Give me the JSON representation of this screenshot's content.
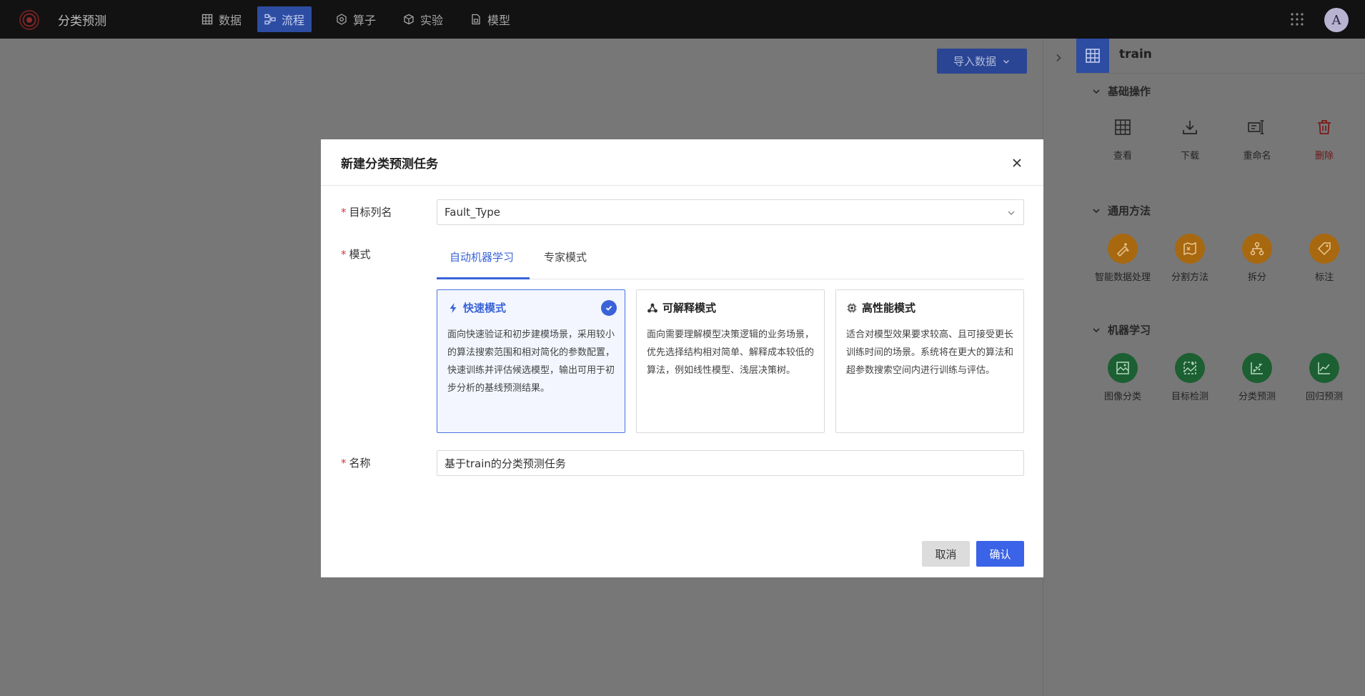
{
  "app": {
    "title": "分类预测"
  },
  "nav": {
    "items": [
      {
        "label": "数据",
        "icon": "table-icon"
      },
      {
        "label": "流程",
        "icon": "flow-icon"
      },
      {
        "label": "算子",
        "icon": "gear-hex-icon"
      },
      {
        "label": "实验",
        "icon": "cube-icon"
      },
      {
        "label": "模型",
        "icon": "model-icon"
      }
    ],
    "active": "流程"
  },
  "user": {
    "avatar_letter": "A"
  },
  "toolbar": {
    "import_label": "导入数据"
  },
  "right_panel": {
    "dataset_name": "train",
    "sections": [
      {
        "title": "基础操作",
        "tools": [
          "查看",
          "下载",
          "重命名",
          "删除"
        ]
      },
      {
        "title": "通用方法",
        "tools": [
          "智能数据处理",
          "分割方法",
          "拆分",
          "标注"
        ]
      },
      {
        "title": "机器学习",
        "tools": [
          "图像分类",
          "目标检测",
          "分类预测",
          "回归预测"
        ]
      }
    ]
  },
  "modal": {
    "title": "新建分类预测任务",
    "required_mark": "*",
    "target_label": "目标列名",
    "target_value": "Fault_Type",
    "mode_label": "模式",
    "tabs": [
      "自动机器学习",
      "专家模式"
    ],
    "active_tab": "自动机器学习",
    "cards": [
      {
        "title": "快速模式",
        "desc": "面向快速验证和初步建模场景，采用较小的算法搜索范围和相对简化的参数配置，快速训练并评估候选模型，输出可用于初步分析的基线预测结果。",
        "selected": true
      },
      {
        "title": "可解释模式",
        "desc": "面向需要理解模型决策逻辑的业务场景，优先选择结构相对简单、解释成本较低的算法，例如线性模型、浅层决策树。",
        "selected": false
      },
      {
        "title": "高性能模式",
        "desc": "适合对模型效果要求较高、且可接受更长训练时间的场景。系统将在更大的算法和超参数搜索空间内进行训练与评估。",
        "selected": false
      }
    ],
    "name_label": "名称",
    "name_value": "基于train的分类预测任务",
    "cancel_label": "取消",
    "confirm_label": "确认"
  },
  "colors": {
    "accent": "#3a63d8",
    "nav_active": "#2d4da3",
    "required": "#d9363e",
    "orange_tool": "#a8680f",
    "green_tool": "#1c5f32",
    "delete_red": "#7a1a1a"
  }
}
